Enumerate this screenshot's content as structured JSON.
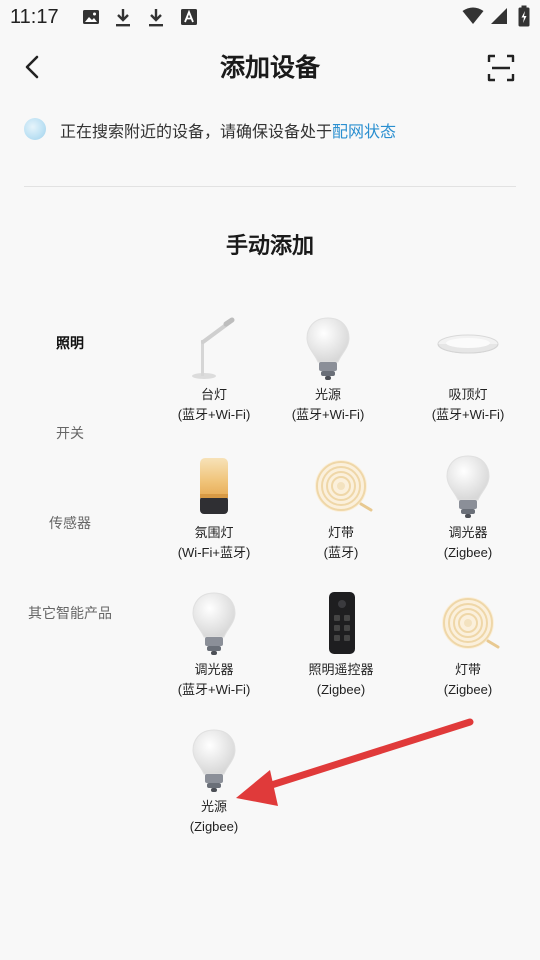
{
  "status_bar": {
    "time": "11:17",
    "left_icons": [
      "image-icon",
      "download-icon",
      "download-icon",
      "font-a-icon"
    ],
    "right_icons": [
      "wifi-icon",
      "signal-icon",
      "battery-charging-icon"
    ]
  },
  "header": {
    "title": "添加设备"
  },
  "notice": {
    "text": "正在搜索附近的设备，请确保设备处于",
    "link": "配网状态",
    "link_color": "#2a8fd0"
  },
  "manual": {
    "title": "手动添加"
  },
  "categories": [
    {
      "label": "照明",
      "active": true
    },
    {
      "label": "开关",
      "active": false
    },
    {
      "label": "传感器",
      "active": false
    },
    {
      "label": "其它智能产品",
      "active": false
    }
  ],
  "devices": [
    {
      "name": "台灯",
      "protocol": "(蓝牙+Wi-Fi)",
      "icon": "desk-lamp-icon"
    },
    {
      "name": "光源",
      "protocol": "(蓝牙+Wi-Fi)",
      "icon": "bulb-icon"
    },
    {
      "name": "吸顶灯",
      "protocol": "(蓝牙+Wi-Fi)",
      "icon": "ceiling-light-icon"
    },
    {
      "name": "氛围灯",
      "protocol": "(Wi-Fi+蓝牙)",
      "icon": "ambient-lamp-icon"
    },
    {
      "name": "灯带",
      "protocol": "(蓝牙)",
      "icon": "light-strip-icon"
    },
    {
      "name": "调光器",
      "protocol": "(Zigbee)",
      "icon": "bulb-icon"
    },
    {
      "name": "调光器",
      "protocol": "(蓝牙+Wi-Fi)",
      "icon": "bulb-icon"
    },
    {
      "name": "照明遥控器",
      "protocol": "(Zigbee)",
      "icon": "remote-control-icon"
    },
    {
      "name": "灯带",
      "protocol": "(Zigbee)",
      "icon": "light-strip-icon"
    },
    {
      "name": "光源",
      "protocol": "(Zigbee)",
      "icon": "bulb-icon"
    }
  ],
  "annotation": {
    "color": "#e03a3a"
  }
}
